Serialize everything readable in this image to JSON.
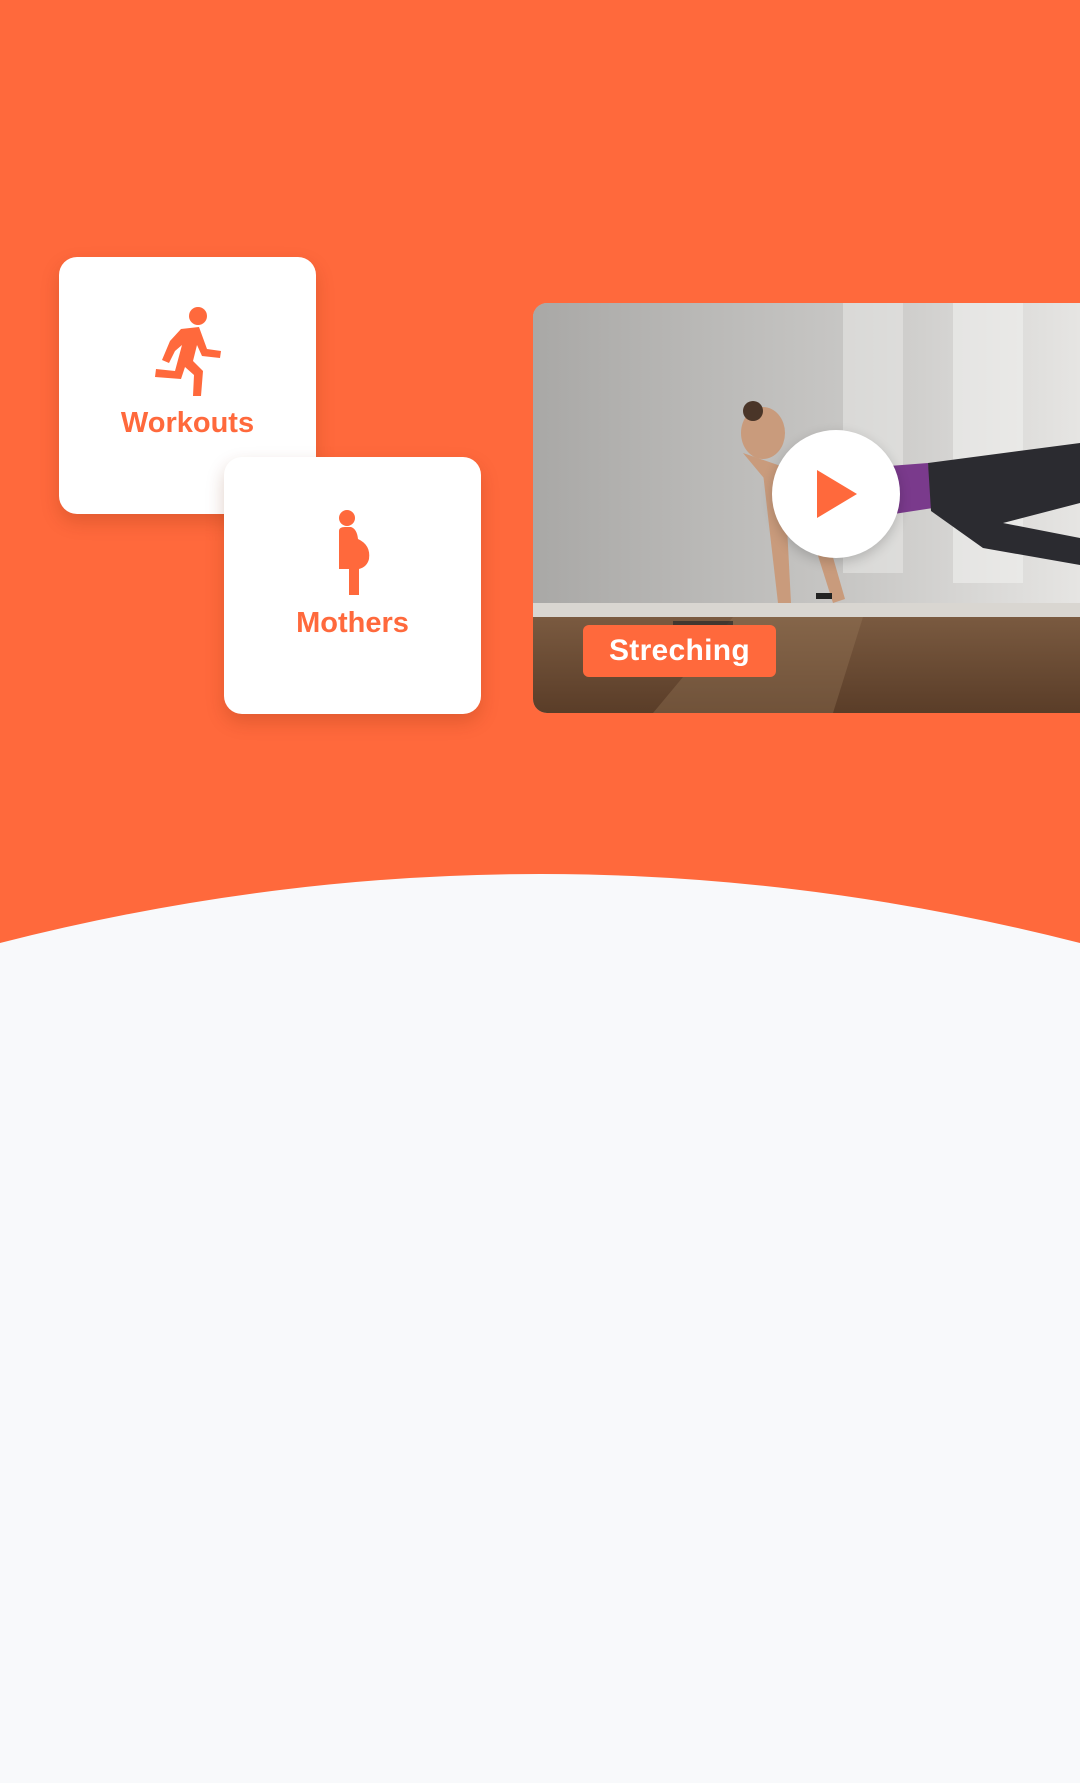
{
  "theme": {
    "accent": "#ff693c",
    "background": "#f8f9fb",
    "card": "#ffffff"
  },
  "categories": [
    {
      "label": "Workouts",
      "icon": "running-person-icon"
    },
    {
      "label": "Mothers",
      "icon": "pregnant-woman-icon"
    }
  ],
  "video": {
    "tag": "Streching",
    "play_icon": "play-icon"
  }
}
